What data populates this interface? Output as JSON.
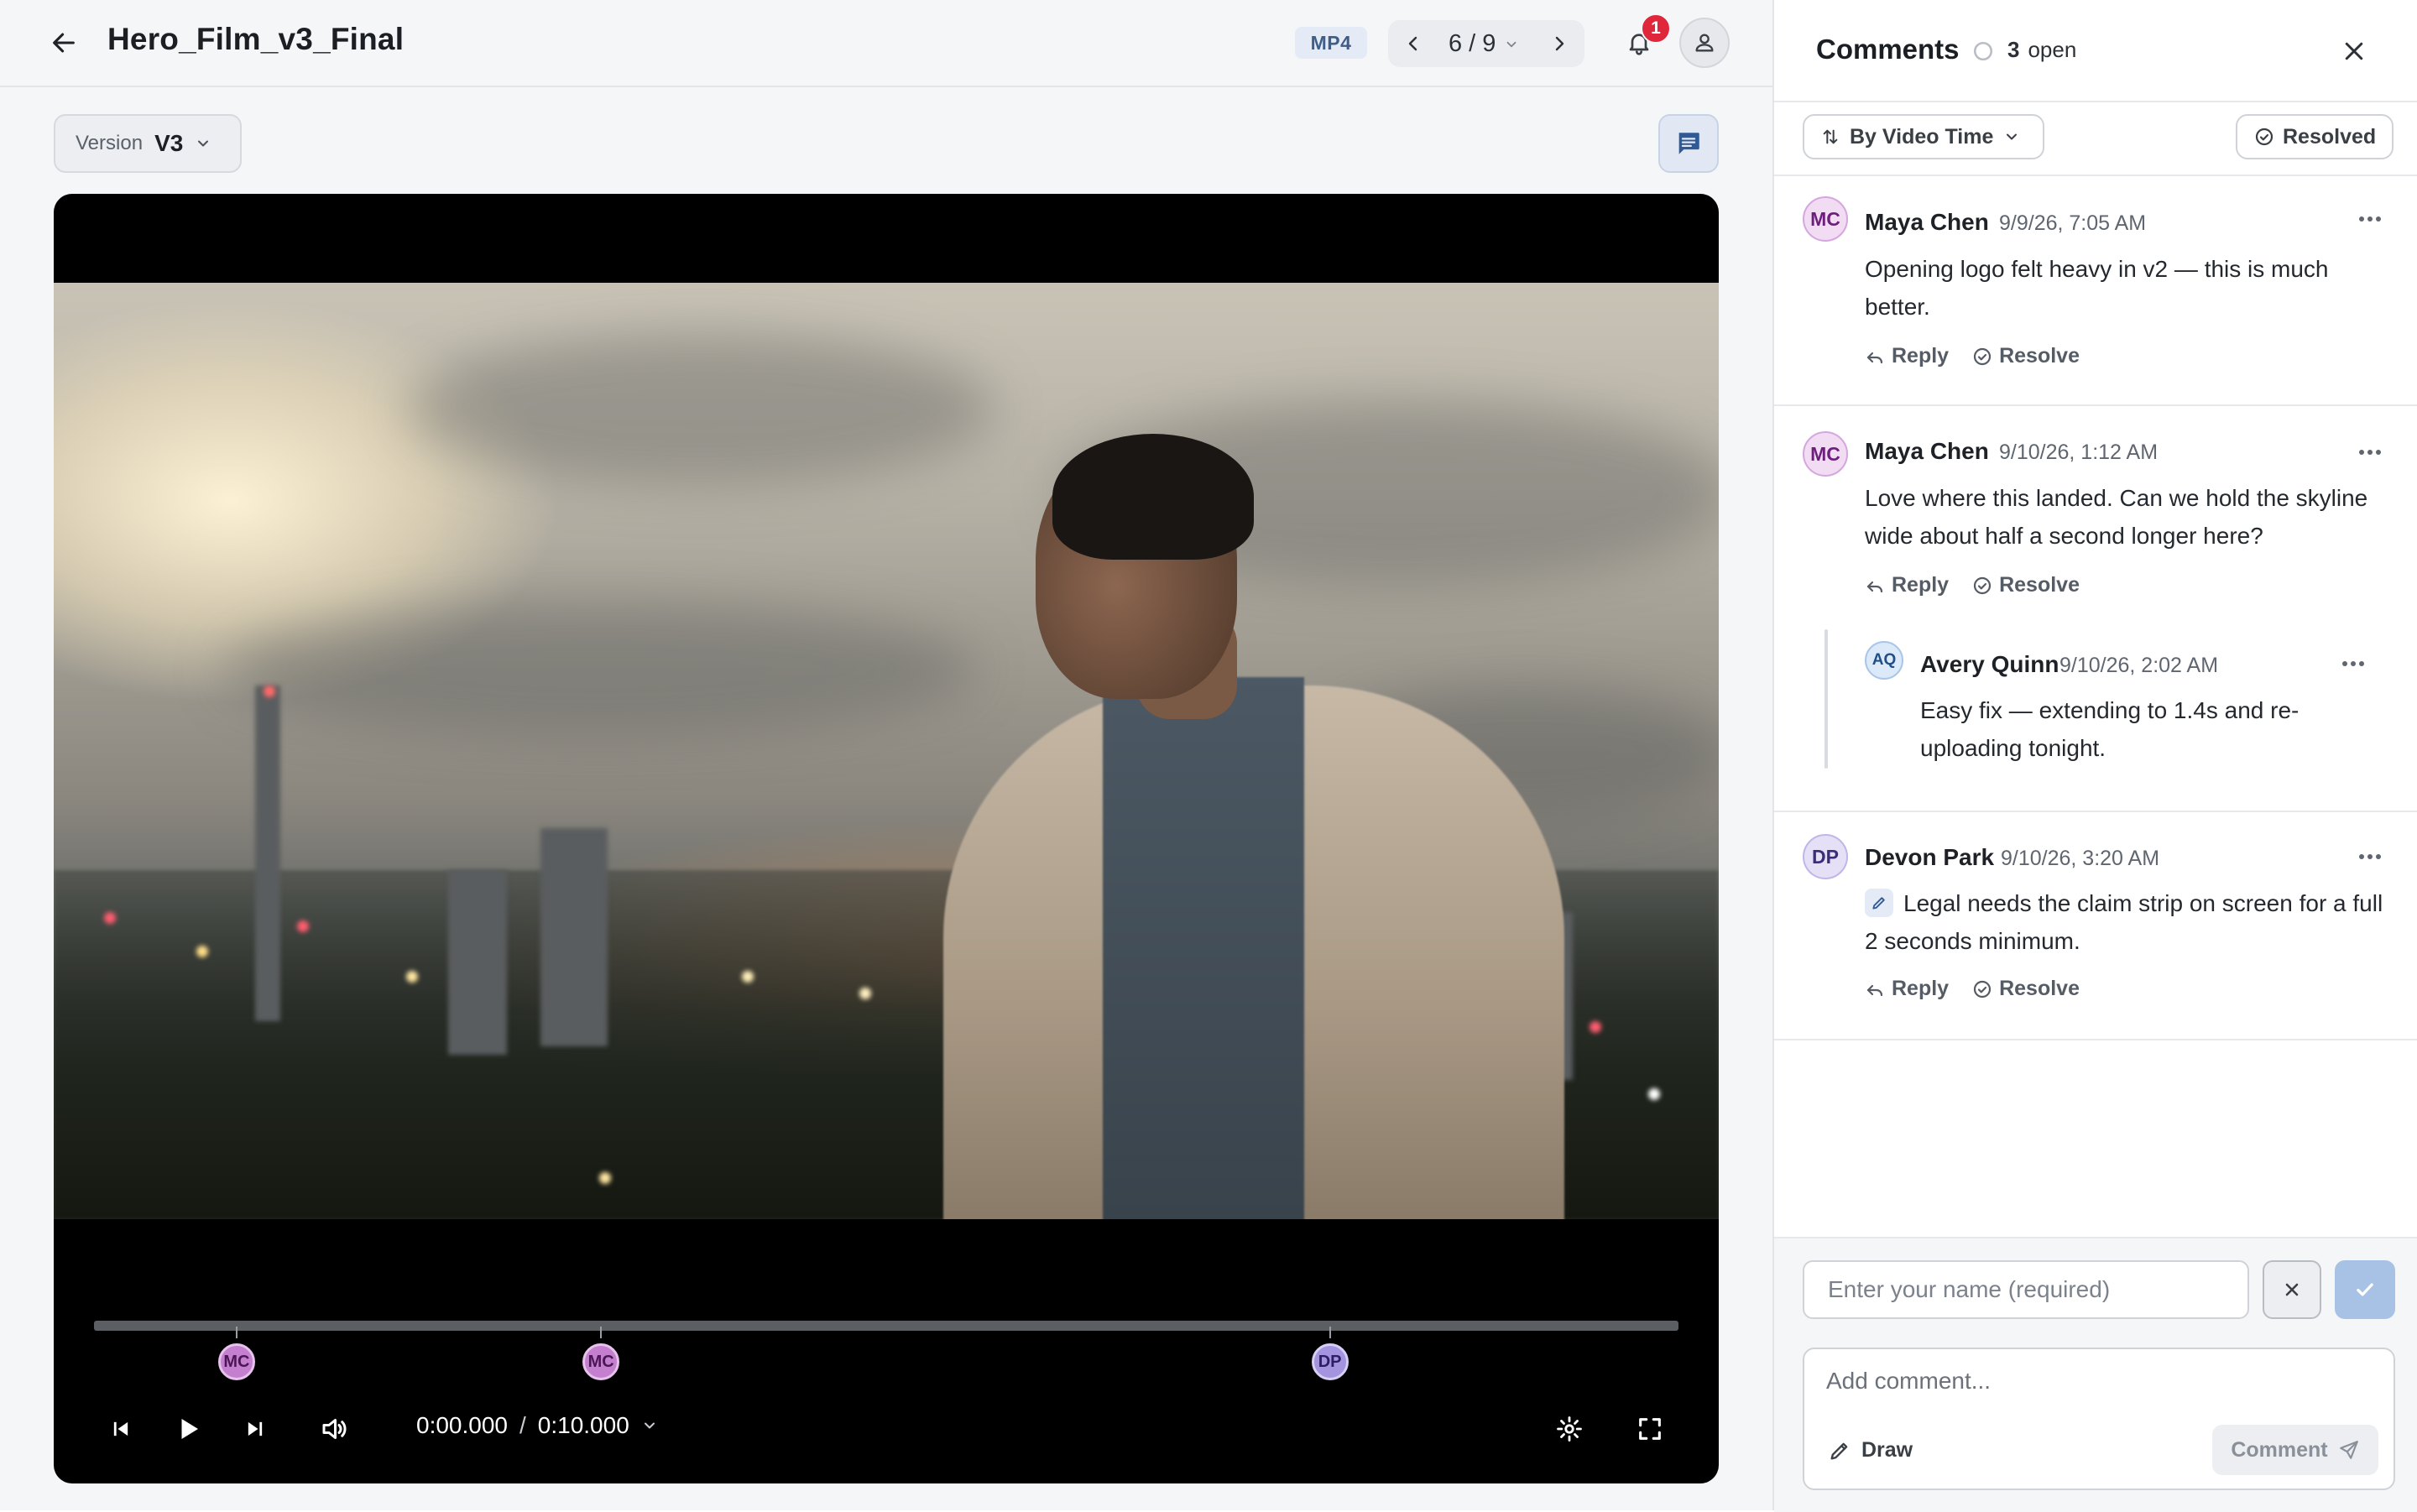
{
  "header": {
    "title": "Hero_Film_v3_Final",
    "format_badge": "MP4",
    "pager_text": "6 / 9",
    "notification_count": "1"
  },
  "version": {
    "label": "Version",
    "value": "V3"
  },
  "player": {
    "current_time": "0:00.000",
    "separator": "/",
    "duration": "0:10.000",
    "markers": [
      {
        "initials": "MC",
        "author": "Maya Chen",
        "position": 0.09
      },
      {
        "initials": "MC",
        "author": "Maya Chen",
        "position": 0.32
      },
      {
        "initials": "DP",
        "author": "Devon Park",
        "position": 0.78
      }
    ]
  },
  "panel": {
    "title": "Comments",
    "open_count": "3",
    "open_label": "open",
    "sort_label": "By Video Time",
    "resolved_label": "Resolved",
    "reply_label": "Reply",
    "resolve_label": "Resolve"
  },
  "comments": [
    {
      "initials": "MC",
      "author": "Maya Chen",
      "time": "9/9/26, 7:05 AM",
      "body": "Opening logo felt heavy in v2 — this is much better."
    },
    {
      "initials": "MC",
      "author": "Maya Chen",
      "time": "9/10/26, 1:12 AM",
      "body": "Love where this landed. Can we hold the skyline wide about half a second longer here?",
      "reply": {
        "initials": "AQ",
        "author": "Avery Quinn",
        "time": "9/10/26, 2:02 AM",
        "body": "Easy fix — extending to 1.4s and re-uploading tonight."
      }
    },
    {
      "initials": "DP",
      "author": "Devon Park",
      "time": "9/10/26, 3:20 AM",
      "body": "Legal needs the claim strip on screen for a full 2 seconds minimum.",
      "has_drawing": true
    }
  ],
  "composer": {
    "name_placeholder": "Enter your name (required)",
    "comment_placeholder": "Add comment...",
    "draw_label": "Draw",
    "submit_label": "Comment"
  },
  "colors": {
    "accent_blue": "#3e5d87",
    "notification_red": "#e0263a",
    "marker_mc": "#c480cf",
    "marker_dp": "#a493de"
  }
}
